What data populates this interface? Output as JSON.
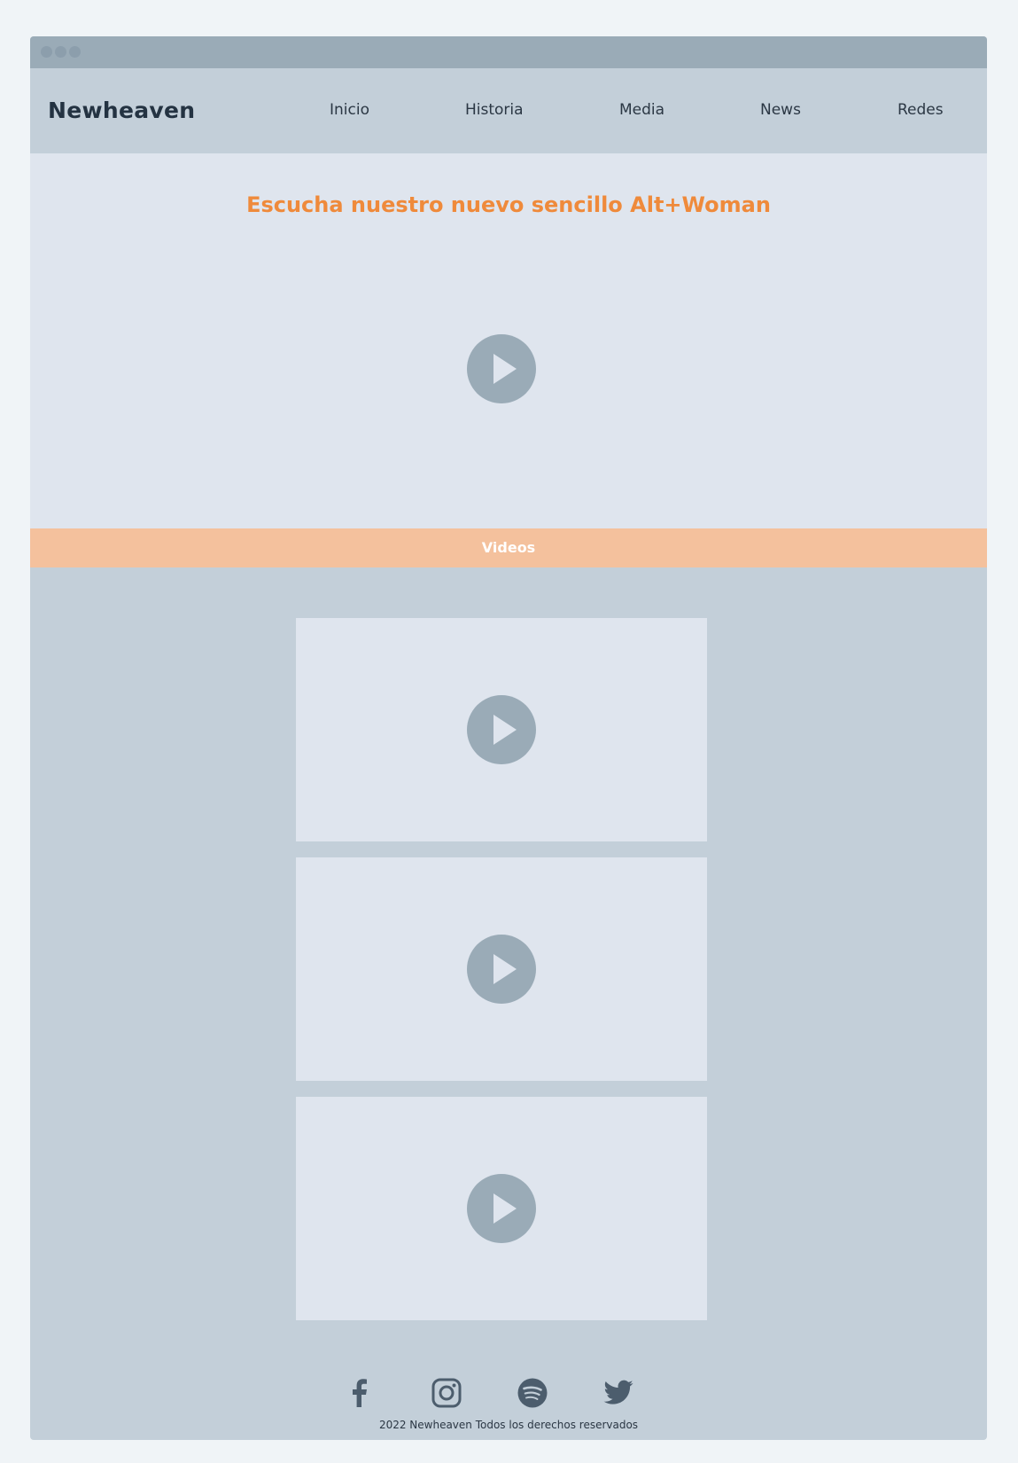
{
  "brand": "Newheaven",
  "nav": {
    "items": [
      {
        "label": "Inicio"
      },
      {
        "label": "Historia"
      },
      {
        "label": "Media"
      },
      {
        "label": "News"
      },
      {
        "label": "Redes"
      }
    ]
  },
  "hero": {
    "title": "Escucha nuestro nuevo sencillo Alt+Woman",
    "play_icon": "play-icon"
  },
  "videos": {
    "section_label": "Videos",
    "items": [
      {
        "play_icon": "play-icon"
      },
      {
        "play_icon": "play-icon"
      },
      {
        "play_icon": "play-icon"
      }
    ]
  },
  "footer": {
    "social": [
      {
        "icon": "facebook-icon"
      },
      {
        "icon": "instagram-icon"
      },
      {
        "icon": "spotify-icon"
      },
      {
        "icon": "twitter-icon"
      }
    ],
    "copyright": "2022 Newheaven Todos los derechos reservados"
  },
  "colors": {
    "accent": "#ef8a3b",
    "section_bar": "#f4c19d",
    "page_bg": "#c3cfd9",
    "card_bg": "#dfe5ee",
    "play_bg": "#9aabb7",
    "text_dark": "#243342"
  }
}
